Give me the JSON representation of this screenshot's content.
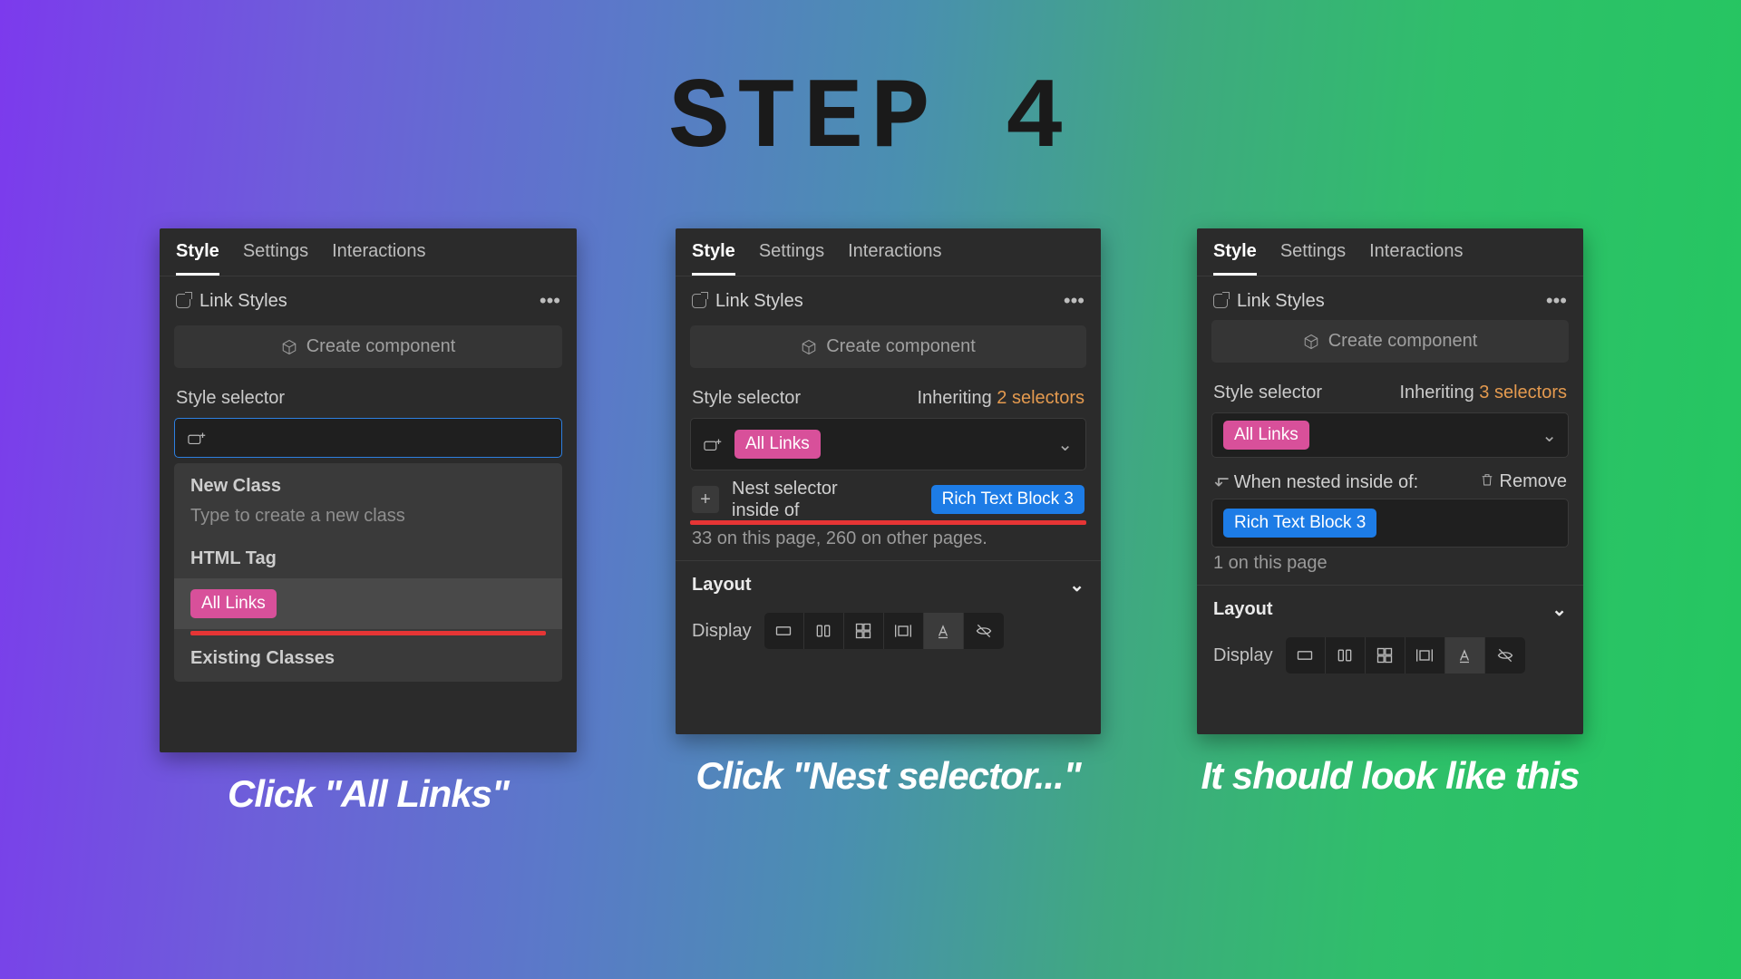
{
  "heading": "STEP 4",
  "tabs": {
    "style": "Style",
    "settings": "Settings",
    "interactions": "Interactions"
  },
  "link_styles": "Link Styles",
  "create_component": "Create component",
  "style_selector": "Style selector",
  "inheriting": "Inheriting",
  "panel1": {
    "new_class": "New Class",
    "hint": "Type to create a new class",
    "html_tag": "HTML Tag",
    "all_links": "All Links",
    "existing": "Existing Classes",
    "caption": "Click \"All Links\""
  },
  "panel2": {
    "inherit_count": "2 selectors",
    "all_links": "All Links",
    "nest_selector": "Nest selector\ninside of",
    "rich_text": "Rich Text Block 3",
    "count": "33 on this page, 260 on other pages.",
    "layout": "Layout",
    "display": "Display",
    "caption": "Click \"Nest selector...\""
  },
  "panel3": {
    "inherit_count": "3 selectors",
    "all_links": "All Links",
    "nested_label": "When nested inside of:",
    "remove": "Remove",
    "rich_text": "Rich Text Block 3",
    "count": "1 on this page",
    "layout": "Layout",
    "display": "Display",
    "caption": "It should look like this"
  }
}
